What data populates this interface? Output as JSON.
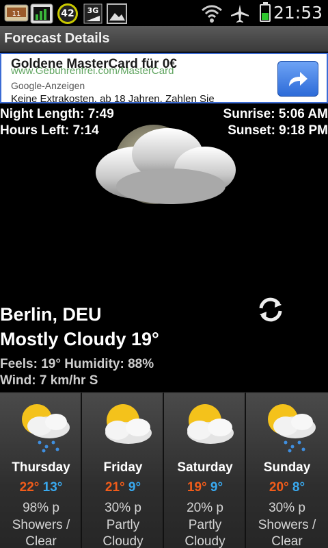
{
  "status_bar": {
    "time": "21:53",
    "badge_number": "42",
    "network_label": "3G",
    "icons": [
      "notification-app-icon",
      "chart-icon",
      "badge-icon",
      "3g-data-icon",
      "image-icon",
      "wifi-icon",
      "airplane-mode-icon",
      "battery-icon"
    ],
    "battery_level": 0.45
  },
  "title_bar": {
    "title": "Forecast Details"
  },
  "ad": {
    "headline": "Goldene MasterCard für 0€",
    "url": "www.Gebuhrenfrei.com/MasterCard",
    "source": "Google-Anzeigen",
    "body": "Keine Extrakosten, ab 18 Jahren, Zahlen Sie",
    "button_icon": "share-arrow-icon"
  },
  "current": {
    "night_length": "Night Length: 7:49",
    "hours_left": "Hours Left: 7:14",
    "sunrise": "Sunrise: 5:06 AM",
    "sunset": "Sunset: 9:18 PM",
    "icon": "night-mostly-cloudy-icon",
    "location": "Berlin, DEU",
    "condition": "Mostly Cloudy 19°",
    "feels_humidity": "Feels: 19° Humidity: 88%",
    "wind": "Wind: 7 km/hr S",
    "refresh_icon": "refresh-icon"
  },
  "forecast": [
    {
      "day": "Thursday",
      "high": "22°",
      "low": "13°",
      "pop": "98% p",
      "desc_line1": "Showers /",
      "desc_line2": "Clear",
      "icon": "sun-cloud-rain-icon"
    },
    {
      "day": "Friday",
      "high": "21°",
      "low": "9°",
      "pop": "30% p",
      "desc_line1": "Partly",
      "desc_line2": "Cloudy",
      "icon": "partly-cloudy-icon"
    },
    {
      "day": "Saturday",
      "high": "19°",
      "low": "9°",
      "pop": "20% p",
      "desc_line1": "Partly",
      "desc_line2": "Cloudy",
      "icon": "partly-cloudy-icon"
    },
    {
      "day": "Sunday",
      "high": "20°",
      "low": "8°",
      "pop": "30% p",
      "desc_line1": "Showers /",
      "desc_line2": "Clear",
      "icon": "sun-cloud-rain-icon"
    }
  ],
  "colors": {
    "high_temp": "#f25c1a",
    "low_temp": "#39a9ef",
    "ad_border": "#3b6bd4"
  }
}
